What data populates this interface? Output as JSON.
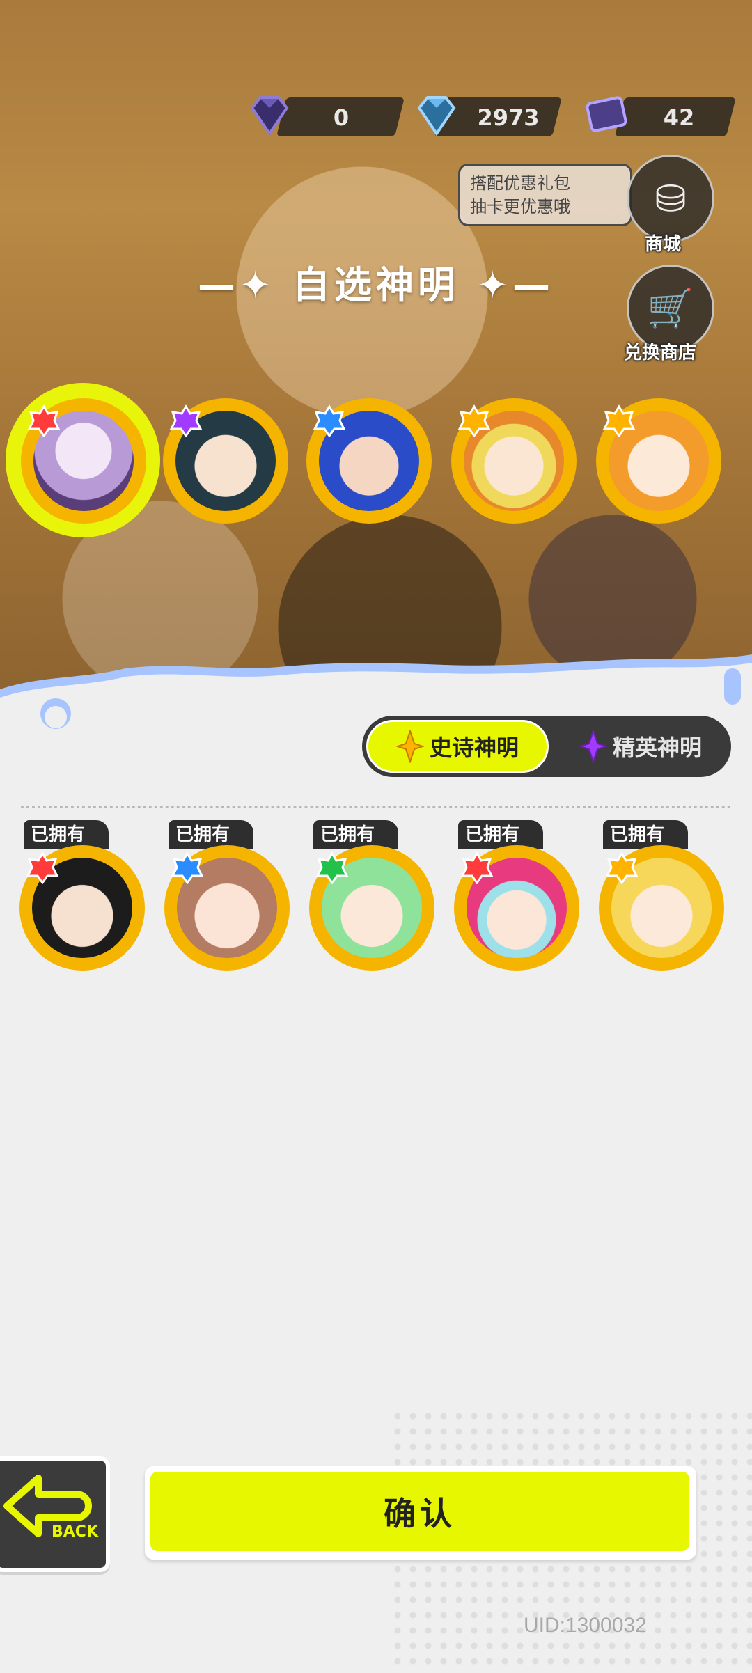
{
  "currency": [
    {
      "icon": "purple-diamond-icon",
      "value": "0"
    },
    {
      "icon": "blue-diamond-icon",
      "value": "2973"
    },
    {
      "icon": "ticket-icon",
      "value": "42"
    }
  ],
  "promo": {
    "line1": "搭配优惠礼包",
    "line2": "抽卡更优惠哦"
  },
  "shop_button": {
    "label": "商城"
  },
  "exchange_button": {
    "label": "兑换商店"
  },
  "title": "自选神明",
  "title_left": "—✦",
  "title_right": "✦—",
  "tabs": {
    "epic": "史诗神明",
    "elite": "精英神明",
    "active": "epic"
  },
  "owned_label": "已拥有",
  "confirm_label": "确认",
  "back_label": "BACK",
  "uid": "UID:1300032",
  "colors": {
    "accent": "#e6f700",
    "frame": "#f5b400",
    "dark": "#3a3a3a"
  }
}
